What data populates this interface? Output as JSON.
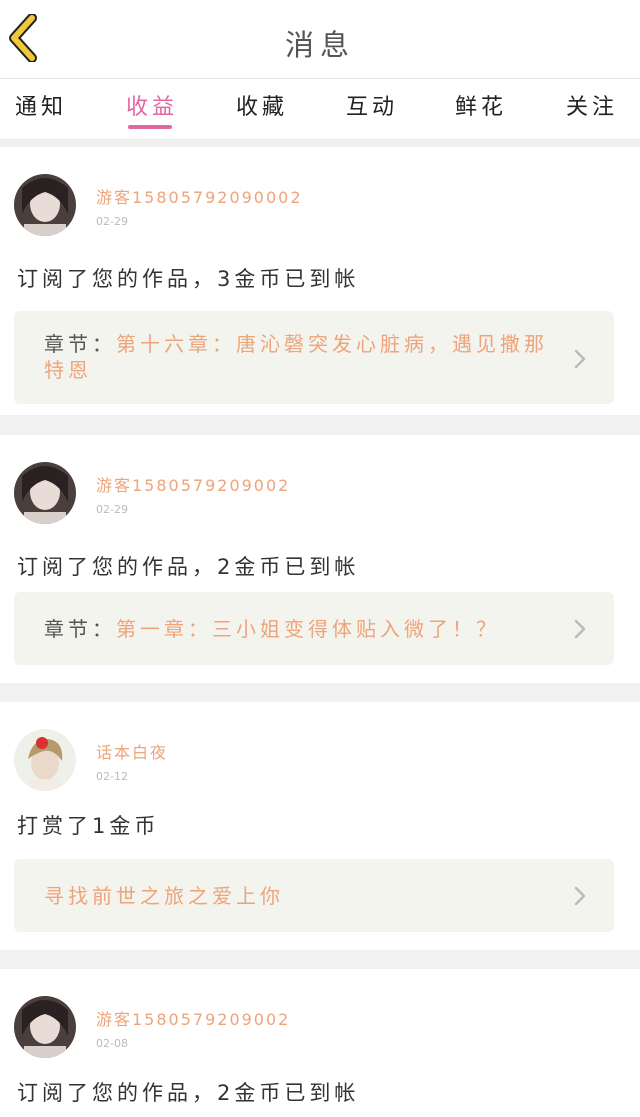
{
  "header": {
    "back_label": "",
    "title": "消息"
  },
  "tabs": [
    {
      "label": "通知"
    },
    {
      "label": "收益"
    },
    {
      "label": "收藏"
    },
    {
      "label": "互动"
    },
    {
      "label": "鲜花"
    },
    {
      "label": "关注"
    }
  ],
  "active_tab": "收益",
  "colors": {
    "accent": "#e2679f",
    "username": "#eea47a",
    "back_arrow_fill": "#f0c93a",
    "back_arrow_stroke": "#222222",
    "card_bg": "#f4f4ef"
  },
  "icons": {
    "back": "chevron-left-icon",
    "row": "chevron-right-icon"
  },
  "messages": [
    {
      "username": "游客15805792090002",
      "date": "02-29",
      "text": "订阅了您的作品，3金币已到帐",
      "chapter_prefix": "章节：",
      "chapter_title": "第十六章：唐沁磬突发心脏病，遇见撒那特恩"
    },
    {
      "username": "游客1580579209002",
      "date": "02-29",
      "text": "订阅了您的作品，2金币已到帐",
      "chapter_prefix": "章节：",
      "chapter_title": "第一章：三小姐变得体贴入微了！？"
    },
    {
      "username": "话本白夜",
      "date": "02-12",
      "text": "打赏了1金币",
      "chapter_prefix": "",
      "chapter_title": "寻找前世之旅之爱上你"
    },
    {
      "username": "游客1580579209002",
      "date": "02-08",
      "text": "订阅了您的作品，2金币已到帐"
    }
  ]
}
